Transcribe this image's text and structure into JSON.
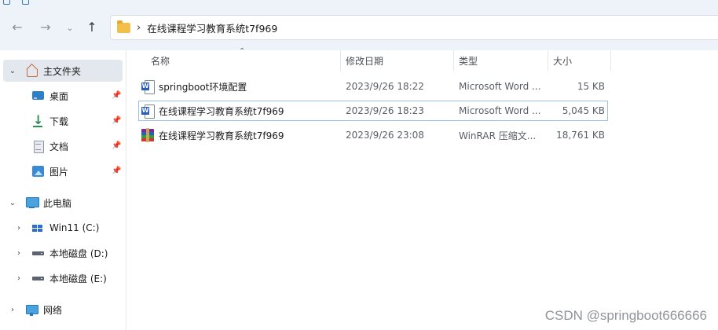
{
  "toolbar": {
    "back_icon": "back-arrow-icon",
    "forward_icon": "forward-arrow-icon",
    "recent_icon": "chevron-down-icon",
    "up_icon": "up-arrow-icon",
    "address": {
      "folder_icon": "folder-icon",
      "separator": "›",
      "path_segment": "在线课程学习教育系统t7f969"
    }
  },
  "sidebar": {
    "home": {
      "label": "主文件夹",
      "expanded": true,
      "selected": true
    },
    "quick_access": [
      {
        "label": "桌面",
        "icon": "desktop-icon",
        "pinned": true
      },
      {
        "label": "下载",
        "icon": "download-icon",
        "pinned": true
      },
      {
        "label": "文档",
        "icon": "document-icon",
        "pinned": true
      },
      {
        "label": "图片",
        "icon": "pictures-icon",
        "pinned": true
      }
    ],
    "this_pc": {
      "label": "此电脑",
      "expanded": true
    },
    "drives": [
      {
        "label": "Win11 (C:)",
        "icon": "windows-drive-icon"
      },
      {
        "label": "本地磁盘 (D:)",
        "icon": "drive-icon"
      },
      {
        "label": "本地磁盘 (E:)",
        "icon": "drive-icon"
      }
    ],
    "network": {
      "label": "网络"
    }
  },
  "columns": {
    "name": "名称",
    "modified": "修改日期",
    "type": "类型",
    "size": "大小"
  },
  "files": [
    {
      "name": "springboot环境配置",
      "modified": "2023/9/26 18:22",
      "type": "Microsoft Word ...",
      "size": "15 KB",
      "icon": "word-document-icon",
      "selected": false
    },
    {
      "name": "在线课程学习教育系统t7f969",
      "modified": "2023/9/26 18:23",
      "type": "Microsoft Word ...",
      "size": "5,045 KB",
      "icon": "word-document-icon",
      "selected": true
    },
    {
      "name": "在线课程学习教育系统t7f969",
      "modified": "2023/9/26 23:08",
      "type": "WinRAR 压缩文...",
      "size": "18,761 KB",
      "icon": "winrar-archive-icon",
      "selected": false
    }
  ],
  "watermark": "CSDN @springboot666666",
  "colors": {
    "toolbar_bg": "#eef3f9",
    "selection_border": "#9bc1e6",
    "sidebar_selected_bg": "#e3e8ef"
  }
}
